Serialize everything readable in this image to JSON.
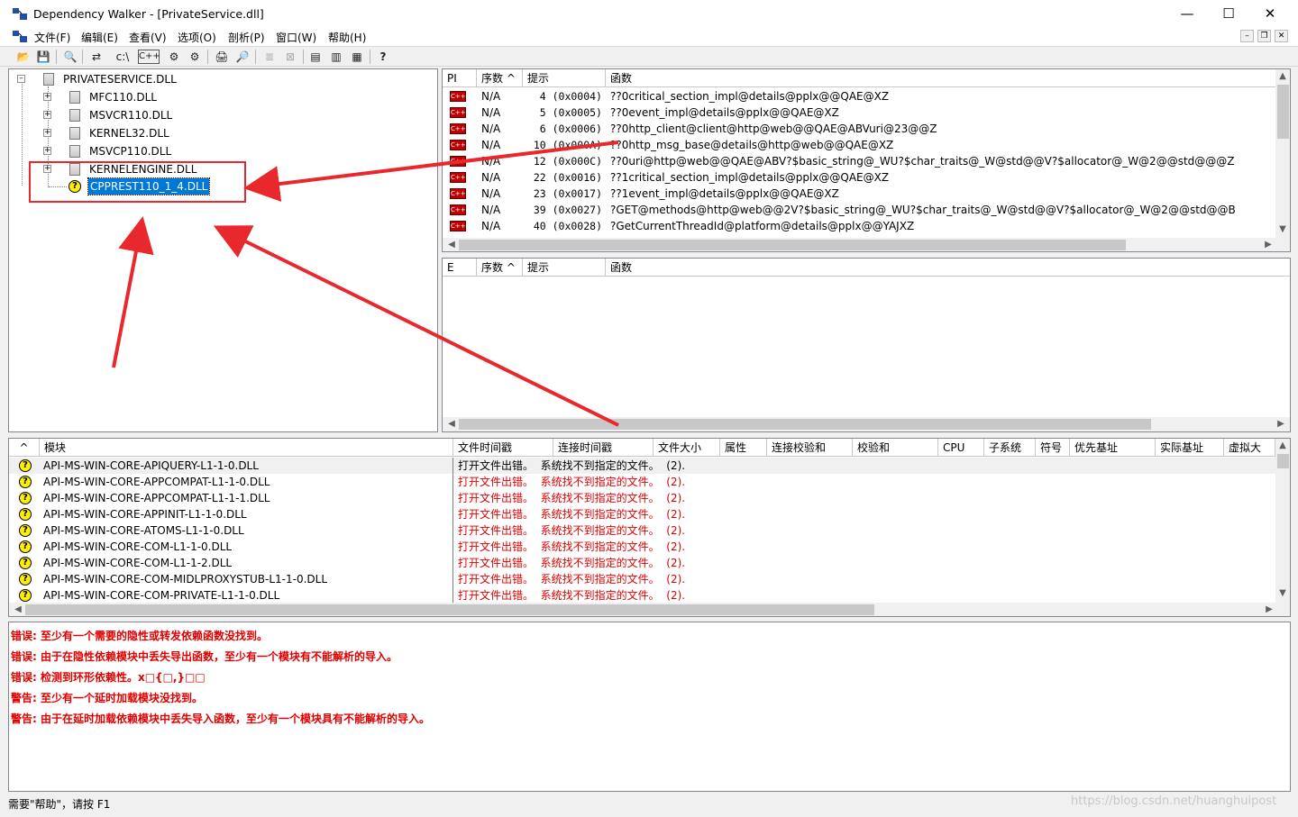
{
  "window": {
    "title": "Dependency Walker - [PrivateService.dll]",
    "minimize": "—",
    "maximize": "☐",
    "close": "✕"
  },
  "menu": [
    "文件(F)",
    "编辑(E)",
    "查看(V)",
    "选项(O)",
    "剖析(P)",
    "窗口(W)",
    "帮助(H)"
  ],
  "toolbar_glyphs": [
    "📂",
    "💾",
    "🔍",
    "⇄",
    "c:\\",
    "C++",
    "⚙",
    "⚙",
    "🖨",
    "🔎",
    "≣",
    "⊠",
    "▤",
    "▥",
    "▦",
    "?"
  ],
  "tree": {
    "root": "PRIVATESERVICE.DLL",
    "children": [
      "MFC110.DLL",
      "MSVCR110.DLL",
      "KERNEL32.DLL",
      "MSVCP110.DLL",
      "KERNELENGINE.DLL"
    ],
    "selected": "CPPREST110_1_4.DLL"
  },
  "import_pane": {
    "headers": [
      "PI",
      "序数 ^",
      "提示",
      "函数"
    ],
    "rows": [
      {
        "pi": "C++",
        "ordinal": "N/A",
        "hint": "4 (0x0004)",
        "func": "??0critical_section_impl@details@pplx@@QAE@XZ"
      },
      {
        "pi": "C++",
        "ordinal": "N/A",
        "hint": "5 (0x0005)",
        "func": "??0event_impl@details@pplx@@QAE@XZ"
      },
      {
        "pi": "C++",
        "ordinal": "N/A",
        "hint": "6 (0x0006)",
        "func": "??0http_client@client@http@web@@QAE@ABVuri@23@@Z"
      },
      {
        "pi": "C++",
        "ordinal": "N/A",
        "hint": "10 (0x000A)",
        "func": "??0http_msg_base@details@http@web@@QAE@XZ"
      },
      {
        "pi": "C++",
        "ordinal": "N/A",
        "hint": "12 (0x000C)",
        "func": "??0uri@http@web@@QAE@ABV?$basic_string@_WU?$char_traits@_W@std@@V?$allocator@_W@2@@std@@@Z"
      },
      {
        "pi": "C++",
        "ordinal": "N/A",
        "hint": "22 (0x0016)",
        "func": "??1critical_section_impl@details@pplx@@QAE@XZ"
      },
      {
        "pi": "C++",
        "ordinal": "N/A",
        "hint": "23 (0x0017)",
        "func": "??1event_impl@details@pplx@@QAE@XZ"
      },
      {
        "pi": "C++",
        "ordinal": "N/A",
        "hint": "39 (0x0027)",
        "func": "?GET@methods@http@web@@2V?$basic_string@_WU?$char_traits@_W@std@@V?$allocator@_W@2@@std@@B"
      },
      {
        "pi": "C++",
        "ordinal": "N/A",
        "hint": "40 (0x0028)",
        "func": "?GetCurrentThreadId@platform@details@pplx@@YAJXZ"
      }
    ]
  },
  "export_pane": {
    "headers": [
      "E",
      "序数 ^",
      "提示",
      "函数"
    ]
  },
  "module_list": {
    "headers": [
      "^",
      "模块",
      "文件时间戳",
      "连接时间戳",
      "文件大小",
      "属性",
      "连接校验和",
      "校验和",
      "CPU",
      "子系统",
      "符号",
      "优先基址",
      "实际基址",
      "虚拟大"
    ],
    "rows": [
      {
        "name": "API-MS-WIN-CORE-APIQUERY-L1-1-0.DLL",
        "msg": "打开文件出错。  系统找不到指定的文件。  (2).",
        "selected": true
      },
      {
        "name": "API-MS-WIN-CORE-APPCOMPAT-L1-1-0.DLL",
        "msg": "打开文件出错。  系统找不到指定的文件。  (2).",
        "selected": false
      },
      {
        "name": "API-MS-WIN-CORE-APPCOMPAT-L1-1-1.DLL",
        "msg": "打开文件出错。  系统找不到指定的文件。  (2).",
        "selected": false
      },
      {
        "name": "API-MS-WIN-CORE-APPINIT-L1-1-0.DLL",
        "msg": "打开文件出错。  系统找不到指定的文件。  (2).",
        "selected": false
      },
      {
        "name": "API-MS-WIN-CORE-ATOMS-L1-1-0.DLL",
        "msg": "打开文件出错。  系统找不到指定的文件。  (2).",
        "selected": false
      },
      {
        "name": "API-MS-WIN-CORE-COM-L1-1-0.DLL",
        "msg": "打开文件出错。  系统找不到指定的文件。  (2).",
        "selected": false
      },
      {
        "name": "API-MS-WIN-CORE-COM-L1-1-2.DLL",
        "msg": "打开文件出错。  系统找不到指定的文件。  (2).",
        "selected": false
      },
      {
        "name": "API-MS-WIN-CORE-COM-MIDLPROXYSTUB-L1-1-0.DLL",
        "msg": "打开文件出错。  系统找不到指定的文件。  (2).",
        "selected": false
      },
      {
        "name": "API-MS-WIN-CORE-COM-PRIVATE-L1-1-0.DLL",
        "msg": "打开文件出错。  系统找不到指定的文件。  (2).",
        "selected": false
      }
    ]
  },
  "log": [
    "错误: 至少有一个需要的隐性或转发依赖函数没找到。",
    "错误: 由于在隐性依赖模块中丢失导出函数，至少有一个模块有不能解析的导入。",
    "错误: 检测到环形依赖性。x□{□,}□□",
    "警告: 至少有一个延时加载模块没找到。",
    "警告: 由于在延时加载依赖模块中丢失导入函数，至少有一个模块具有不能解析的导入。"
  ],
  "status": "需要\"帮助\"，请按 F1",
  "watermark": "https://blog.csdn.net/huanghuipost",
  "colors": {
    "error_text": "#e00000",
    "selection": "#0078d7",
    "annotation": "#e8282d"
  }
}
